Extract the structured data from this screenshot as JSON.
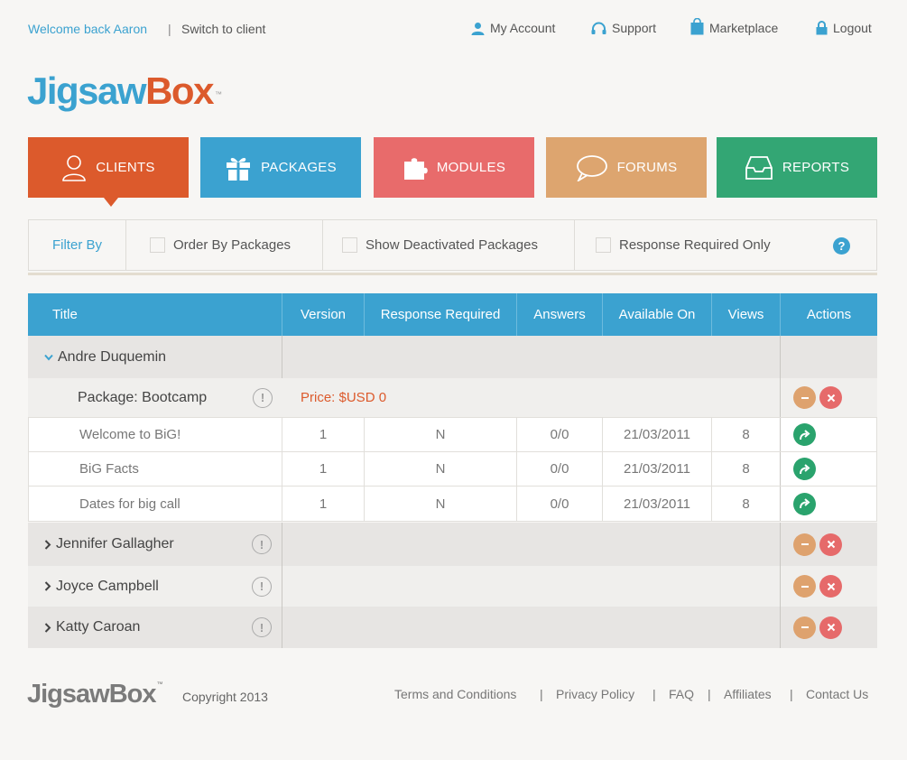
{
  "header": {
    "welcome": "Welcome back Aaron",
    "separator": "|",
    "switch_label": "Switch to client",
    "links": {
      "account": "My Account",
      "support": "Support",
      "marketplace": "Marketplace",
      "logout": "Logout"
    }
  },
  "brand": {
    "logo_part1": "Jigsaw",
    "logo_part2": "Box",
    "tm": "™"
  },
  "colors": {
    "clients": "#dc5a2c",
    "packages": "#3ba2d0",
    "modules": "#e86b6b",
    "forums": "#dda56f",
    "reports": "#33a674"
  },
  "nav": {
    "clients": "CLIENTS",
    "packages": "PACKAGES",
    "modules": "MODULES",
    "forums": "FORUMS",
    "reports": "REPORTS"
  },
  "filter": {
    "label": "Filter By",
    "order_by_packages": "Order By Packages",
    "show_deactivated": "Show Deactivated Packages",
    "response_required_only": "Response Required Only",
    "help": "?"
  },
  "table": {
    "columns": {
      "title": "Title",
      "version": "Version",
      "response_required": "Response Required",
      "answers": "Answers",
      "available_on": "Available On",
      "views": "Views",
      "actions": "Actions"
    },
    "clients": {
      "andre": "Andre Duquemin",
      "jennifer": "Jennifer Gallagher",
      "joyce": "Joyce Campbell",
      "katty": "Katty Caroan"
    },
    "package": {
      "name": "Package: Bootcamp",
      "price": "Price: $USD 0"
    },
    "modules": [
      {
        "title": "Welcome to BiG!",
        "version": "1",
        "response": "N",
        "answers": "0/0",
        "available": "21/03/2011",
        "views": "8"
      },
      {
        "title": "BiG Facts",
        "version": "1",
        "response": "N",
        "answers": "0/0",
        "available": "21/03/2011",
        "views": "8"
      },
      {
        "title": "Dates for big call",
        "version": "1",
        "response": "N",
        "answers": "0/0",
        "available": "21/03/2011",
        "views": "8"
      }
    ],
    "excl": "!"
  },
  "footer": {
    "logo": "JigsawBox",
    "tm": "™",
    "copyright": "Copyright 2013",
    "links": {
      "terms": "Terms and Conditions",
      "privacy": "Privacy Policy",
      "faq": "FAQ",
      "affiliates": "Affiliates",
      "contact": "Contact Us"
    },
    "separator": "|"
  },
  "icons": [
    "user-icon",
    "headset-icon",
    "shopping-bag-icon",
    "lock-icon",
    "person-icon",
    "gift-icon",
    "puzzle-icon",
    "speech-bubble-icon",
    "inbox-tray-icon",
    "chevron-down-icon",
    "chevron-right-icon",
    "exclamation-icon",
    "minus-icon",
    "close-icon",
    "forward-arrow-icon",
    "help-icon"
  ]
}
